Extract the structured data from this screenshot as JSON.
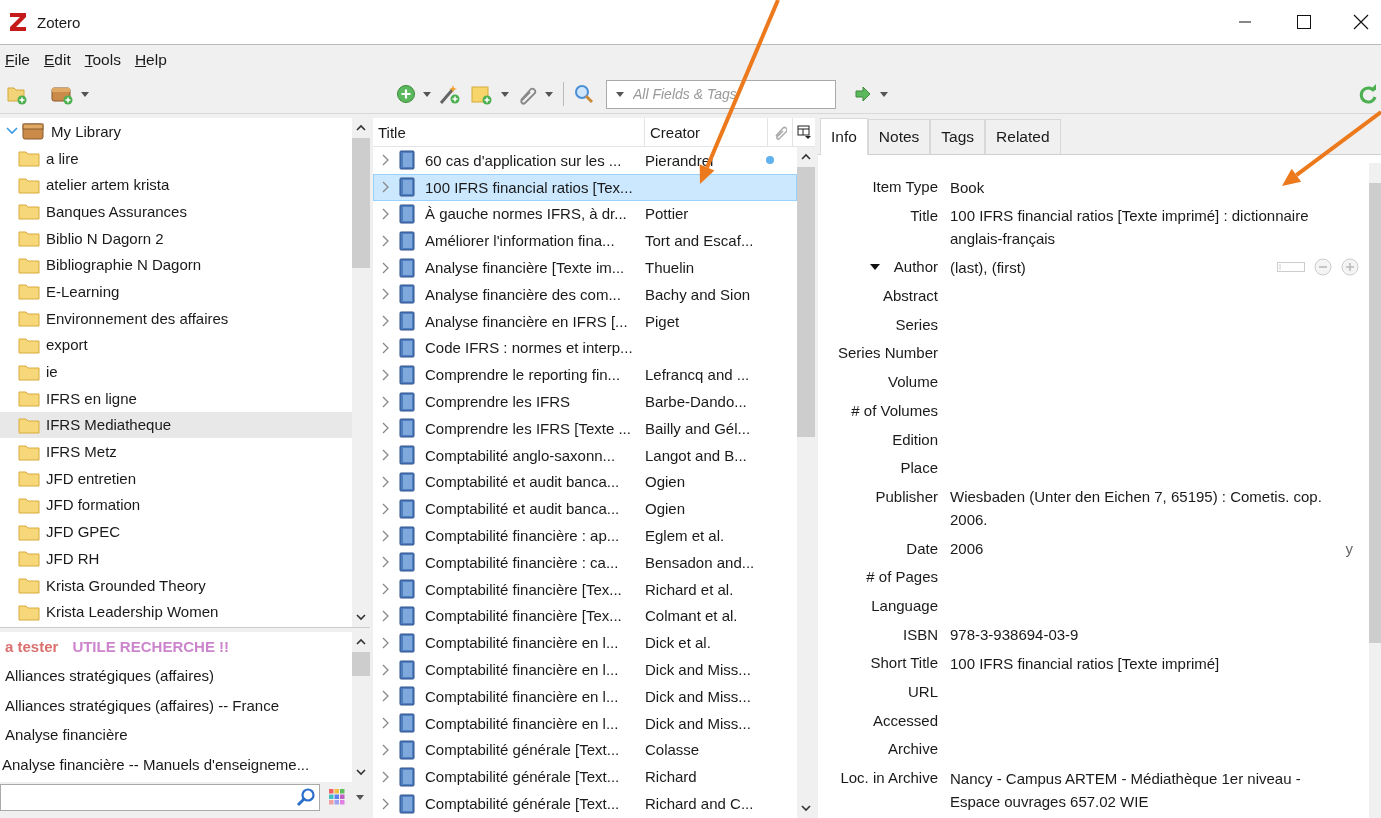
{
  "window": {
    "title": "Zotero"
  },
  "menu": [
    {
      "label": "File"
    },
    {
      "label": "Edit"
    },
    {
      "label": "Tools"
    },
    {
      "label": "Help"
    }
  ],
  "search": {
    "placeholder": "All Fields & Tags"
  },
  "collections": [
    {
      "label": "My Library",
      "kind": "library",
      "expanded": true,
      "selected": false
    },
    {
      "label": "a lire",
      "kind": "folder",
      "selected": false
    },
    {
      "label": "atelier artem krista",
      "kind": "folder",
      "selected": false
    },
    {
      "label": "Banques Assurances",
      "kind": "folder",
      "selected": false
    },
    {
      "label": "Biblio N Dagorn 2",
      "kind": "folder",
      "selected": false
    },
    {
      "label": "Bibliographie N Dagorn",
      "kind": "folder",
      "selected": false
    },
    {
      "label": "E-Learning",
      "kind": "folder",
      "selected": false
    },
    {
      "label": "Environnement des affaires",
      "kind": "folder",
      "selected": false
    },
    {
      "label": "export",
      "kind": "folder",
      "selected": false
    },
    {
      "label": "ie",
      "kind": "folder",
      "selected": false
    },
    {
      "label": "IFRS en ligne",
      "kind": "folder",
      "selected": false
    },
    {
      "label": "IFRS Mediatheque",
      "kind": "folder",
      "selected": true
    },
    {
      "label": "IFRS Metz",
      "kind": "folder",
      "selected": false
    },
    {
      "label": "JFD entretien",
      "kind": "folder",
      "selected": false
    },
    {
      "label": "JFD formation",
      "kind": "folder",
      "selected": false
    },
    {
      "label": "JFD GPEC",
      "kind": "folder",
      "selected": false
    },
    {
      "label": "JFD RH",
      "kind": "folder",
      "selected": false
    },
    {
      "label": "Krista Grounded Theory",
      "kind": "folder",
      "selected": false
    },
    {
      "label": "Krista Leadership Women",
      "kind": "folder",
      "selected": false
    }
  ],
  "colored_tags": [
    {
      "label": "a tester",
      "color": "#d9706e"
    },
    {
      "label": "UTILE RECHERCHE !!",
      "color": "#cc85cc"
    }
  ],
  "tags": [
    "Alliances stratégiques (affaires)",
    "Alliances stratégiques (affaires) -- France",
    "Analyse financière",
    "Analyse financière -- Manuels d'enseigneme..."
  ],
  "items_table": {
    "columns": [
      "Title",
      "Creator"
    ],
    "rows": [
      {
        "title": "60 cas d'application sur les ...",
        "creator": "Pierandrei",
        "attachment": true,
        "selected": false
      },
      {
        "title": "100 IFRS financial ratios [Tex...",
        "creator": "",
        "attachment": false,
        "selected": true
      },
      {
        "title": "À gauche normes IFRS, à dr...",
        "creator": "Pottier",
        "attachment": false,
        "selected": false
      },
      {
        "title": "Améliorer l'information fina...",
        "creator": "Tort and Escaf...",
        "attachment": false,
        "selected": false
      },
      {
        "title": "Analyse financière [Texte im...",
        "creator": "Thuelin",
        "attachment": false,
        "selected": false
      },
      {
        "title": "Analyse financière des com...",
        "creator": "Bachy and Sion",
        "attachment": false,
        "selected": false
      },
      {
        "title": "Analyse financière en IFRS [...",
        "creator": "Piget",
        "attachment": false,
        "selected": false
      },
      {
        "title": "Code IFRS : normes et interp...",
        "creator": "",
        "attachment": false,
        "selected": false
      },
      {
        "title": "Comprendre le reporting fin...",
        "creator": "Lefrancq and ...",
        "attachment": false,
        "selected": false
      },
      {
        "title": "Comprendre les IFRS",
        "creator": "Barbe-Dando...",
        "attachment": false,
        "selected": false
      },
      {
        "title": "Comprendre les IFRS [Texte ...",
        "creator": "Bailly and Gél...",
        "attachment": false,
        "selected": false
      },
      {
        "title": "Comptabilité anglo-saxonn...",
        "creator": "Langot and B...",
        "attachment": false,
        "selected": false
      },
      {
        "title": "Comptabilité et audit banca...",
        "creator": "Ogien",
        "attachment": false,
        "selected": false
      },
      {
        "title": "Comptabilité et audit banca...",
        "creator": "Ogien",
        "attachment": false,
        "selected": false
      },
      {
        "title": "Comptabilité financière : ap...",
        "creator": "Eglem et al.",
        "attachment": false,
        "selected": false
      },
      {
        "title": "Comptabilité financière : ca...",
        "creator": "Bensadon and...",
        "attachment": false,
        "selected": false
      },
      {
        "title": "Comptabilité financière [Tex...",
        "creator": "Richard et al.",
        "attachment": false,
        "selected": false
      },
      {
        "title": "Comptabilité financière [Tex...",
        "creator": "Colmant et al.",
        "attachment": false,
        "selected": false
      },
      {
        "title": "Comptabilité financière en l...",
        "creator": "Dick et al.",
        "attachment": false,
        "selected": false
      },
      {
        "title": "Comptabilité financière en l...",
        "creator": "Dick and Miss...",
        "attachment": false,
        "selected": false
      },
      {
        "title": "Comptabilité financière en l...",
        "creator": "Dick and Miss...",
        "attachment": false,
        "selected": false
      },
      {
        "title": "Comptabilité financière en l...",
        "creator": "Dick and Miss...",
        "attachment": false,
        "selected": false
      },
      {
        "title": "Comptabilité générale [Text...",
        "creator": "Colasse",
        "attachment": false,
        "selected": false
      },
      {
        "title": "Comptabilité générale [Text...",
        "creator": "Richard",
        "attachment": false,
        "selected": false
      },
      {
        "title": "Comptabilité générale [Text...",
        "creator": "Richard and C...",
        "attachment": false,
        "selected": false
      }
    ]
  },
  "item_pane": {
    "tabs": [
      {
        "label": "Info",
        "selected": true
      },
      {
        "label": "Notes",
        "selected": false
      },
      {
        "label": "Tags",
        "selected": false
      },
      {
        "label": "Related",
        "selected": false
      }
    ],
    "fields": [
      {
        "kind": "text",
        "label": "Item Type",
        "value": "Book"
      },
      {
        "kind": "text",
        "label": "Title",
        "value": "100 IFRS financial ratios [Texte imprimé] : dictionnaire anglais-français"
      },
      {
        "kind": "creator",
        "label": "Author",
        "value": "(last), (first)"
      },
      {
        "kind": "text",
        "label": "Abstract"
      },
      {
        "kind": "text",
        "label": "Series"
      },
      {
        "kind": "text",
        "label": "Series Number"
      },
      {
        "kind": "text",
        "label": "Volume"
      },
      {
        "kind": "text",
        "label": "# of Volumes"
      },
      {
        "kind": "text",
        "label": "Edition"
      },
      {
        "kind": "text",
        "label": "Place"
      },
      {
        "kind": "text",
        "label": "Publisher",
        "value": "Wiesbaden (Unter den Eichen 7, 65195) : Cometis. cop. 2006."
      },
      {
        "kind": "date",
        "label": "Date",
        "value": "2006",
        "flag": "y"
      },
      {
        "kind": "text",
        "label": "# of Pages"
      },
      {
        "kind": "text",
        "label": "Language"
      },
      {
        "kind": "text",
        "label": "ISBN",
        "value": "978-3-938694-03-9"
      },
      {
        "kind": "text",
        "label": "Short Title",
        "value": "100 IFRS financial ratios [Texte imprimé]"
      },
      {
        "kind": "text",
        "label": "URL"
      },
      {
        "kind": "text",
        "label": "Accessed"
      },
      {
        "kind": "text",
        "label": "Archive"
      },
      {
        "kind": "text",
        "label": "Loc. in Archive",
        "value": "Nancy - Campus ARTEM - Médiathèque 1er niveau - Espace ouvrages 657.02 WIE"
      }
    ]
  },
  "annotations": [
    {
      "kind": "arrow"
    },
    {
      "kind": "arrow"
    }
  ]
}
